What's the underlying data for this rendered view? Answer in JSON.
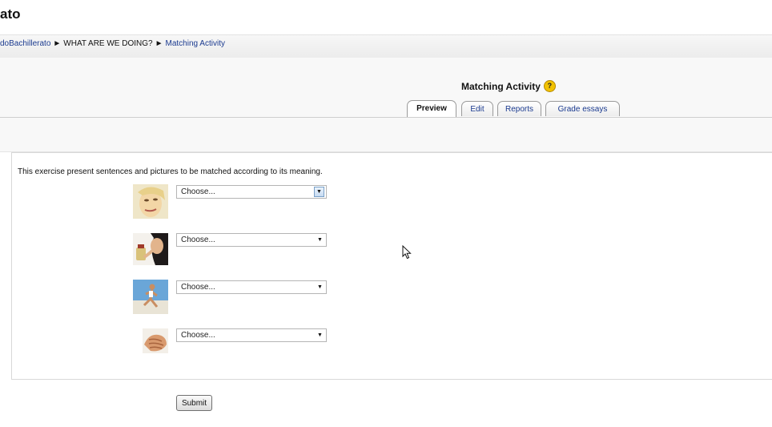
{
  "site": {
    "title": "ato"
  },
  "breadcrumb": {
    "items": [
      "doBachillerato",
      "WHAT ARE WE DOING?",
      "Matching Activity"
    ],
    "separator": "►"
  },
  "activity": {
    "title": "Matching Activity",
    "help_icon": "help-icon"
  },
  "tabs": [
    "Preview",
    "Edit",
    "Reports",
    "Grade essays"
  ],
  "active_tab": "Preview",
  "question": {
    "intro": "This exercise present sentences and pictures to be matched according to its meaning.",
    "items": [
      {
        "image": "face-photo",
        "select_value": "Choose..."
      },
      {
        "image": "person-eating-photo",
        "select_value": "Choose..."
      },
      {
        "image": "runner-photo",
        "select_value": "Choose..."
      },
      {
        "image": "hand-photo",
        "select_value": "Choose..."
      }
    ]
  },
  "submit_label": "Submit",
  "colors": {
    "link": "#1a3a8f",
    "header_bg": "#f8f8f8",
    "help_icon": "#f2c200"
  }
}
